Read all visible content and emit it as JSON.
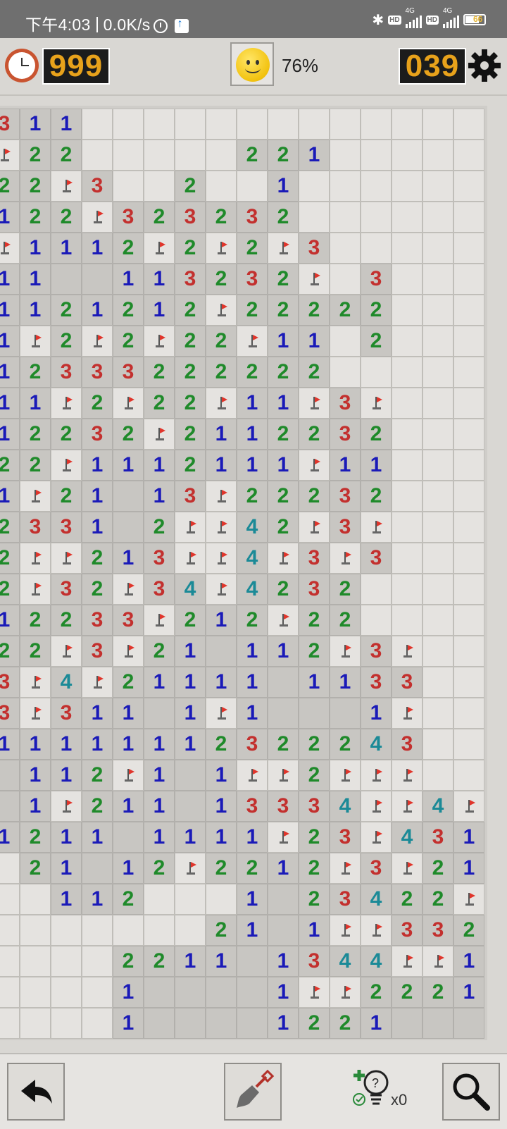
{
  "status_bar": {
    "time": "下午4:03",
    "speed": "0.0K/s",
    "battery": "66",
    "network_1": "4G",
    "network_2": "4G",
    "hd_1": "HD",
    "hd_2": "HD"
  },
  "header": {
    "timer": "999",
    "progress": "76%",
    "mines_left": "039"
  },
  "colors": {
    "lcd_text": "#e8a21b",
    "lcd_bg": "#1c1c1c",
    "num1": "#1a1ab8",
    "num2": "#1f8a2a",
    "num3": "#c3302e",
    "num4": "#1b8a97",
    "flag": "#e0352b"
  },
  "board": {
    "legend": "c = covered, f = flag, e = revealed empty, 1-4 = revealed number",
    "rows": [
      [
        "3",
        "1",
        "1",
        "c",
        "c",
        "c",
        "c",
        "c",
        "c",
        "c",
        "c",
        "c",
        "c",
        "c",
        "c",
        "c"
      ],
      [
        "f",
        "2",
        "2",
        "c",
        "c",
        "c",
        "c",
        "c",
        "2",
        "2",
        "1",
        "c",
        "c",
        "c",
        "c",
        "c"
      ],
      [
        "2",
        "2",
        "f",
        "3",
        "c",
        "c",
        "2",
        "c",
        "c",
        "1",
        "c",
        "c",
        "c",
        "c",
        "c",
        "c"
      ],
      [
        "1",
        "2",
        "2",
        "f",
        "3",
        "2",
        "3",
        "2",
        "3",
        "2",
        "c",
        "c",
        "c",
        "c",
        "c",
        "c"
      ],
      [
        "f",
        "1",
        "1",
        "1",
        "2",
        "f",
        "2",
        "f",
        "2",
        "f",
        "3",
        "c",
        "c",
        "c",
        "c",
        "c"
      ],
      [
        "1",
        "1",
        "e",
        "e",
        "1",
        "1",
        "3",
        "2",
        "3",
        "2",
        "f",
        "c",
        "3",
        "c",
        "c",
        "c"
      ],
      [
        "1",
        "1",
        "2",
        "1",
        "2",
        "1",
        "2",
        "f",
        "2",
        "2",
        "2",
        "2",
        "2",
        "c",
        "c",
        "c"
      ],
      [
        "1",
        "f",
        "2",
        "f",
        "2",
        "f",
        "2",
        "2",
        "f",
        "1",
        "1",
        "c",
        "2",
        "c",
        "c",
        "c"
      ],
      [
        "1",
        "2",
        "3",
        "3",
        "3",
        "2",
        "2",
        "2",
        "2",
        "2",
        "2",
        "c",
        "c",
        "c",
        "c",
        "c"
      ],
      [
        "1",
        "1",
        "f",
        "2",
        "f",
        "2",
        "2",
        "f",
        "1",
        "1",
        "f",
        "3",
        "f",
        "c",
        "c",
        "c"
      ],
      [
        "1",
        "2",
        "2",
        "3",
        "2",
        "f",
        "2",
        "1",
        "1",
        "2",
        "2",
        "3",
        "2",
        "c",
        "c",
        "c"
      ],
      [
        "2",
        "2",
        "f",
        "1",
        "1",
        "1",
        "2",
        "1",
        "1",
        "1",
        "f",
        "1",
        "1",
        "c",
        "c",
        "c"
      ],
      [
        "1",
        "f",
        "2",
        "1",
        "e",
        "1",
        "3",
        "f",
        "2",
        "2",
        "2",
        "3",
        "2",
        "c",
        "c",
        "c"
      ],
      [
        "2",
        "3",
        "3",
        "1",
        "e",
        "2",
        "f",
        "f",
        "4",
        "2",
        "f",
        "3",
        "f",
        "c",
        "c",
        "c"
      ],
      [
        "2",
        "f",
        "f",
        "2",
        "1",
        "3",
        "f",
        "f",
        "4",
        "f",
        "3",
        "f",
        "3",
        "c",
        "c",
        "c"
      ],
      [
        "2",
        "f",
        "3",
        "2",
        "f",
        "3",
        "4",
        "f",
        "4",
        "2",
        "3",
        "2",
        "c",
        "c",
        "c",
        "c"
      ],
      [
        "1",
        "2",
        "2",
        "3",
        "3",
        "f",
        "2",
        "1",
        "2",
        "f",
        "2",
        "2",
        "c",
        "c",
        "c",
        "c"
      ],
      [
        "2",
        "2",
        "f",
        "3",
        "f",
        "2",
        "1",
        "e",
        "1",
        "1",
        "2",
        "f",
        "3",
        "f",
        "c",
        "c"
      ],
      [
        "3",
        "f",
        "4",
        "f",
        "2",
        "1",
        "1",
        "1",
        "1",
        "e",
        "1",
        "1",
        "3",
        "3",
        "c",
        "c"
      ],
      [
        "3",
        "f",
        "3",
        "1",
        "1",
        "e",
        "1",
        "f",
        "1",
        "e",
        "e",
        "e",
        "1",
        "f",
        "c",
        "c"
      ],
      [
        "1",
        "1",
        "1",
        "1",
        "1",
        "1",
        "1",
        "2",
        "3",
        "2",
        "2",
        "2",
        "4",
        "3",
        "c",
        "c"
      ],
      [
        "e",
        "1",
        "1",
        "2",
        "f",
        "1",
        "e",
        "1",
        "f",
        "f",
        "2",
        "f",
        "f",
        "f",
        "c",
        "c"
      ],
      [
        "e",
        "1",
        "f",
        "2",
        "1",
        "1",
        "e",
        "1",
        "3",
        "3",
        "3",
        "4",
        "f",
        "f",
        "4",
        "f"
      ],
      [
        "1",
        "2",
        "1",
        "1",
        "e",
        "1",
        "1",
        "1",
        "1",
        "f",
        "2",
        "3",
        "f",
        "4",
        "3",
        "1"
      ],
      [
        "c",
        "2",
        "1",
        "e",
        "1",
        "2",
        "f",
        "2",
        "2",
        "1",
        "2",
        "f",
        "3",
        "f",
        "2",
        "1"
      ],
      [
        "c",
        "c",
        "1",
        "1",
        "2",
        "c",
        "c",
        "c",
        "1",
        "e",
        "2",
        "3",
        "4",
        "2",
        "2",
        "f"
      ],
      [
        "c",
        "c",
        "c",
        "c",
        "c",
        "c",
        "c",
        "2",
        "1",
        "e",
        "1",
        "f",
        "f",
        "3",
        "3",
        "2"
      ],
      [
        "c",
        "c",
        "c",
        "c",
        "2",
        "2",
        "1",
        "1",
        "e",
        "1",
        "3",
        "4",
        "4",
        "f",
        "f",
        "1"
      ],
      [
        "c",
        "c",
        "c",
        "c",
        "1",
        "e",
        "e",
        "e",
        "e",
        "1",
        "f",
        "f",
        "2",
        "2",
        "2",
        "1"
      ],
      [
        "c",
        "c",
        "c",
        "c",
        "1",
        "e",
        "e",
        "e",
        "e",
        "1",
        "2",
        "2",
        "1",
        "e",
        "e",
        "e"
      ]
    ]
  },
  "bottom_bar": {
    "undo_icon": "undo-arrow-icon",
    "dig_icon": "shovel-icon",
    "hint_icon": "lightbulb-hint-icon",
    "hint_count": "x0",
    "zoom_icon": "magnifier-icon"
  }
}
